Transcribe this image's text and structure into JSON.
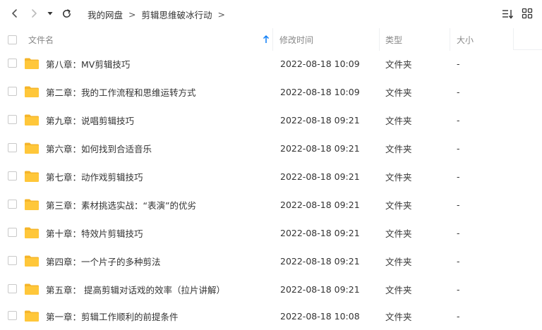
{
  "toolbar": {
    "back_icon": "chevron-left-icon",
    "forward_icon": "chevron-right-icon",
    "dropdown_icon": "caret-down-icon",
    "refresh_icon": "refresh-icon",
    "sort_icon": "sort-list-icon",
    "grid_icon": "grid-view-icon"
  },
  "breadcrumb": {
    "items": [
      "我的网盘",
      "剪辑思维破冰行动"
    ],
    "separator": ">"
  },
  "table": {
    "headers": {
      "name": "文件名",
      "modified": "修改时间",
      "type": "类型",
      "size": "大小"
    },
    "sort_indicator": "up-arrow-icon",
    "rows": [
      {
        "name": "第八章：MV剪辑技巧",
        "modified": "2022-08-18 10:09",
        "type": "文件夹",
        "size": "-"
      },
      {
        "name": "第二章：我的工作流程和思维运转方式",
        "modified": "2022-08-18 10:09",
        "type": "文件夹",
        "size": "-"
      },
      {
        "name": "第九章：说唱剪辑技巧",
        "modified": "2022-08-18 09:21",
        "type": "文件夹",
        "size": "-"
      },
      {
        "name": "第六章：如何找到合适音乐",
        "modified": "2022-08-18 09:21",
        "type": "文件夹",
        "size": "-"
      },
      {
        "name": "第七章：动作戏剪辑技巧",
        "modified": "2022-08-18 09:21",
        "type": "文件夹",
        "size": "-"
      },
      {
        "name": "第三章：素材挑选实战：“表演”的优劣",
        "modified": "2022-08-18 09:21",
        "type": "文件夹",
        "size": "-"
      },
      {
        "name": "第十章：特效片剪辑技巧",
        "modified": "2022-08-18 09:21",
        "type": "文件夹",
        "size": "-"
      },
      {
        "name": "第四章：一个片子的多种剪法",
        "modified": "2022-08-18 09:21",
        "type": "文件夹",
        "size": "-"
      },
      {
        "name": "第五章： 提高剪辑对话戏的效率（拉片讲解）",
        "modified": "2022-08-18 09:21",
        "type": "文件夹",
        "size": "-"
      },
      {
        "name": "第一章：剪辑工作顺利的前提条件",
        "modified": "2022-08-18 10:08",
        "type": "文件夹",
        "size": "-"
      }
    ]
  },
  "colors": {
    "folder": "#FFC73A",
    "folder_dark": "#F5B52A",
    "accent": "#0A7CF7"
  }
}
